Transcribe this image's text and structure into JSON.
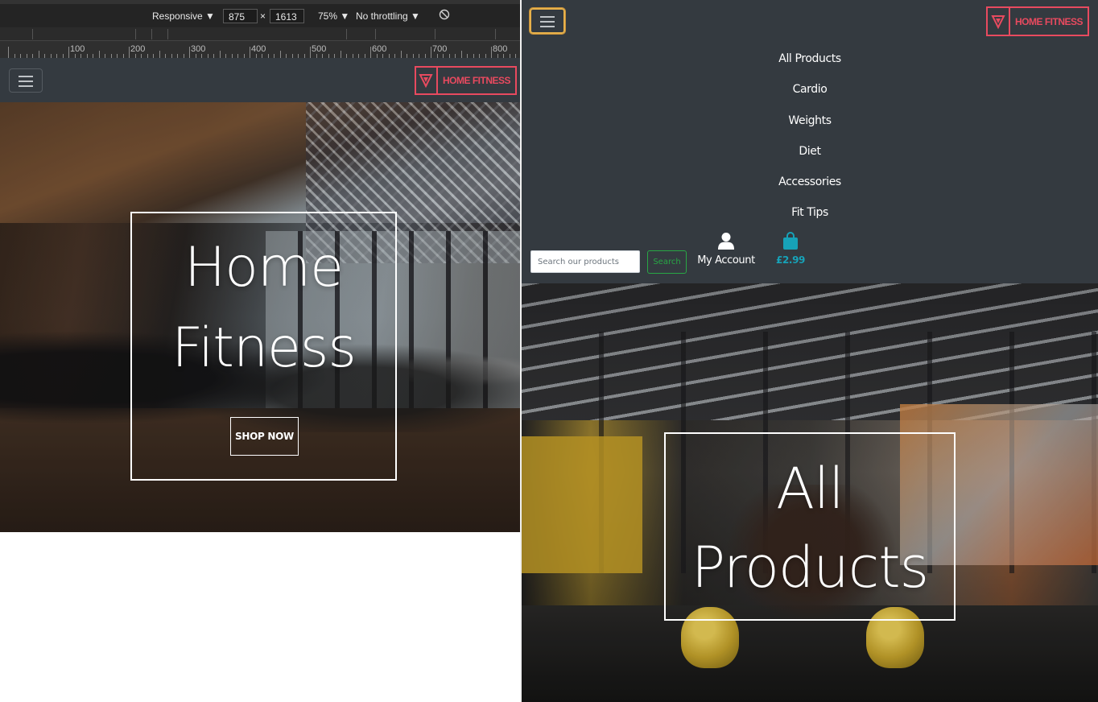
{
  "devtools": {
    "device": "Responsive",
    "width": "875",
    "times": "×",
    "height": "1613",
    "zoom": "75%",
    "throttling": "No throttling",
    "ruler_labels": [
      "100",
      "200",
      "300",
      "400",
      "500",
      "600",
      "700",
      "800"
    ]
  },
  "brand": {
    "logo_text": "HOME FITNESS",
    "accent_color": "#e84a5f"
  },
  "left_hero": {
    "title_line1": "Home",
    "title_line2": "Fitness",
    "cta_label": "SHOP NOW"
  },
  "right_nav": {
    "menu": [
      "All Products",
      "Cardio",
      "Weights",
      "Diet",
      "Accessories",
      "Fit Tips"
    ],
    "search_placeholder": "Search our products",
    "search_button": "Search",
    "account_label": "My Account",
    "bag_total": "£2.99"
  },
  "right_hero": {
    "title_line1": "All",
    "title_line2": "Products"
  },
  "icons": {
    "toggler": "hamburger-icon",
    "logo": "triangle-logo-icon",
    "account": "user-icon",
    "bag": "shopping-bag-icon",
    "rotate": "rotate-icon",
    "dropdown": "caret-down-icon"
  }
}
